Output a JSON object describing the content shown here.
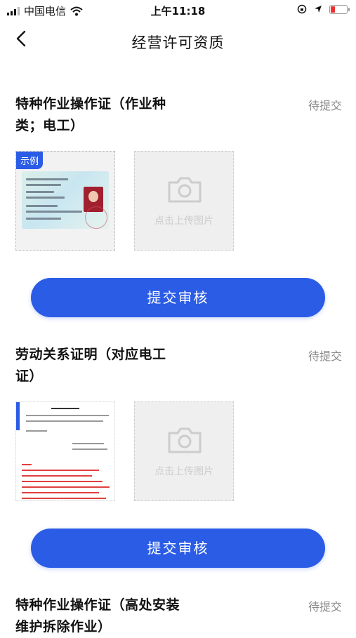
{
  "status_bar": {
    "carrier": "中国电信",
    "time": "上午11:18"
  },
  "nav": {
    "title": "经营许可资质"
  },
  "sections": [
    {
      "title": "特种作业操作证（作业种类；电工）",
      "status": "待提交",
      "sample_badge": "示例",
      "upload_text": "点击上传图片",
      "submit_label": "提交审核"
    },
    {
      "title": "劳动关系证明（对应电工证）",
      "status": "待提交",
      "upload_text": "点击上传图片",
      "submit_label": "提交审核"
    },
    {
      "title": "特种作业操作证（高处安装维护拆除作业）",
      "status": "待提交"
    }
  ],
  "colors": {
    "accent": "#2b5ce6",
    "status_gray": "#888888"
  },
  "icons": [
    "signal-icon",
    "wifi-icon",
    "location-icon",
    "battery-icon",
    "back-chevron-icon",
    "camera-icon"
  ]
}
